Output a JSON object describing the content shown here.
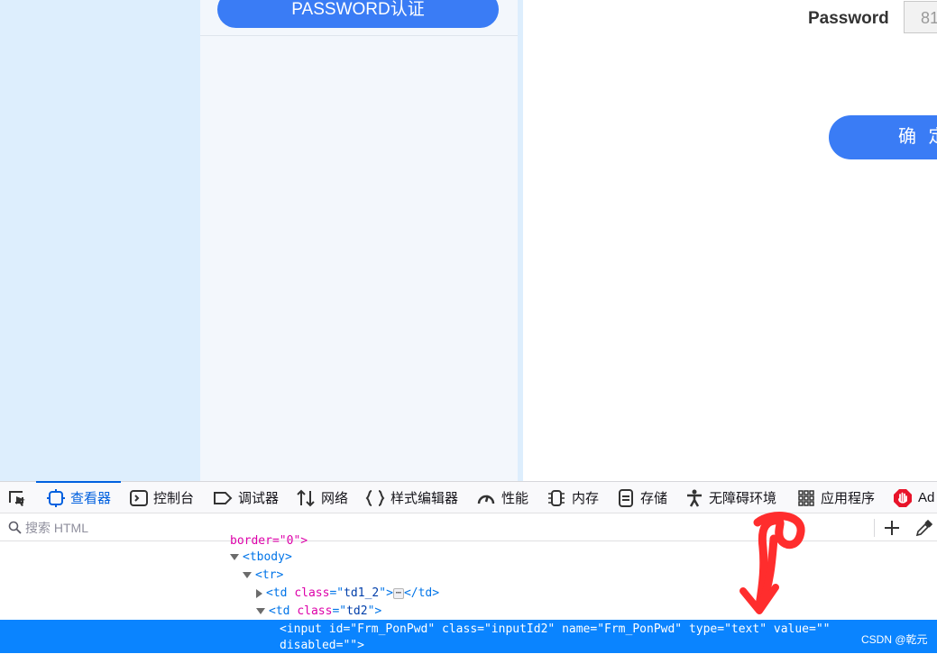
{
  "page": {
    "password_auth_button": "PASSWORD认证",
    "password_label": "Password",
    "password_value": "81",
    "confirm_button": "确 定"
  },
  "devtools": {
    "tabs": [
      {
        "label": "查看器"
      },
      {
        "label": "控制台"
      },
      {
        "label": "调试器"
      },
      {
        "label": "网络"
      },
      {
        "label": "样式编辑器"
      },
      {
        "label": "性能"
      },
      {
        "label": "内存"
      },
      {
        "label": "存储"
      },
      {
        "label": "无障碍环境"
      },
      {
        "label": "应用程序"
      },
      {
        "label": "Ad"
      }
    ],
    "search_placeholder": "搜索 HTML",
    "tree": {
      "line0": "border=\"0\">",
      "tbody": "<tbody>",
      "tr": "<tr>",
      "td1_open": "<td ",
      "td1_attr": "class",
      "td1_eq": "=\"",
      "td1_val": "td1_2",
      "td1_close": "\">",
      "td1_end": "</td>",
      "td2_open": "<td ",
      "td2_attr": "class",
      "td2_eq": "=\"",
      "td2_val": "td2",
      "td2_close": "\">",
      "selected_line1": "<input id=\"Frm_PonPwd\" class=\"inputId2\" name=\"Frm_PonPwd\" type=\"text\" value=\"\"",
      "selected_line2": "disabled=\"\">"
    },
    "ellipsis": "⋯"
  },
  "watermark": "CSDN @乾元",
  "colors": {
    "primary_button": "#3a7cf5",
    "selection": "#0a84ff",
    "annotation": "#ff2d2d"
  }
}
